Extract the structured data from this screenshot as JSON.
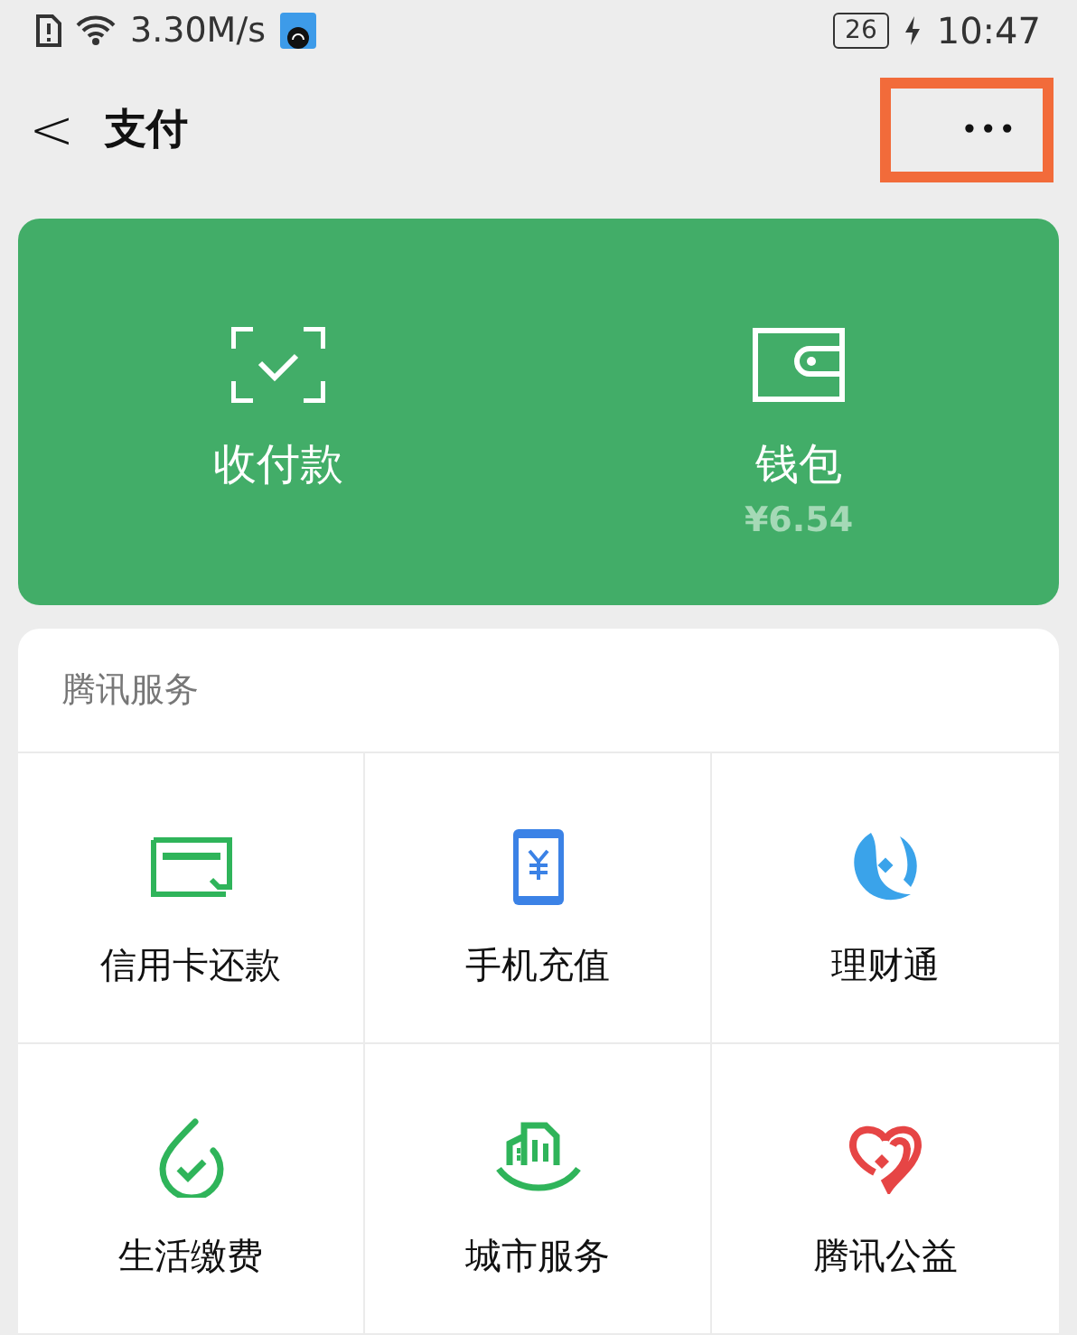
{
  "status_bar": {
    "speed": "3.30M/s",
    "battery": "26",
    "charging": true,
    "time": "10:47"
  },
  "header": {
    "back": "<",
    "title": "支付",
    "more": "•••",
    "highlighted": true
  },
  "wallet_card": {
    "items": [
      {
        "label": "收付款"
      },
      {
        "label": "钱包",
        "amount": "¥6.54"
      }
    ]
  },
  "services": {
    "title": "腾讯服务",
    "items": [
      {
        "label": "信用卡还款"
      },
      {
        "label": "手机充值"
      },
      {
        "label": "理财通"
      },
      {
        "label": "生活缴费"
      },
      {
        "label": "城市服务"
      },
      {
        "label": "腾讯公益"
      }
    ]
  }
}
